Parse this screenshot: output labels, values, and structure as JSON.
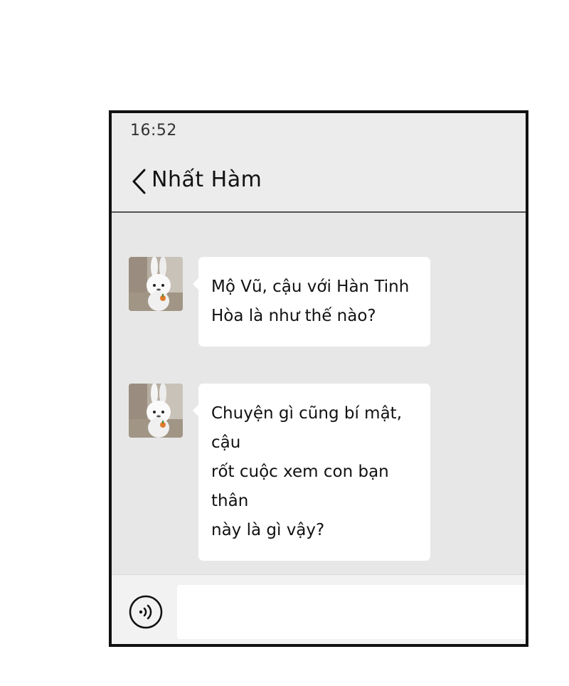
{
  "status_bar": {
    "time": "16:52"
  },
  "header": {
    "back_icon": "chevron-left-icon",
    "contact_name": "Nhất Hàm"
  },
  "messages": [
    {
      "sender": "Nhất Hàm",
      "avatar_icon": "bunny-avatar",
      "text": "Mộ Vũ, cậu với Hàn Tinh\nHòa là như thế nào?"
    },
    {
      "sender": "Nhất Hàm",
      "avatar_icon": "bunny-avatar",
      "text": "Chuyện gì cũng bí mật, cậu\nrốt cuộc xem con bạn thân\nnày là gì vậy?"
    }
  ],
  "input_bar": {
    "voice_icon": "voice-icon",
    "message_value": "",
    "message_placeholder": ""
  },
  "colors": {
    "chat_background": "#e7e7e7",
    "bubble": "#ffffff",
    "text": "#111111",
    "frame": "#111111"
  }
}
